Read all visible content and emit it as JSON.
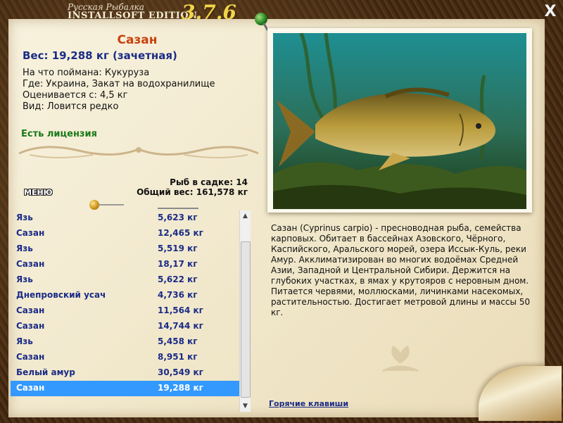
{
  "logo": {
    "line1": "Русская Рыбалка",
    "line2": "INSTALLSOFT EDITION",
    "version": "3.7.6"
  },
  "window": {
    "close_label": "X"
  },
  "catch": {
    "name": "Сазан",
    "weight": "Вес: 19,288 кг (зачетная)",
    "bait": "На что поймана: Кукуруза",
    "place": "Где: Украина, Закат на водохранилище",
    "rated_from": "Оценивается с: 4,5 кг",
    "kind": "Вид: Ловится редко",
    "license": "Есть лицензия"
  },
  "keepnet": {
    "count": "Рыб в садке: 14",
    "total_weight": "Общий вес: 161,578 кг"
  },
  "menu_label": "МЕНЮ",
  "catch_list": [
    {
      "name": "Язь",
      "weight": "5,623 кг"
    },
    {
      "name": "Сазан",
      "weight": "12,465 кг"
    },
    {
      "name": "Язь",
      "weight": "5,519 кг"
    },
    {
      "name": "Сазан",
      "weight": "18,17 кг"
    },
    {
      "name": "Язь",
      "weight": "5,622 кг"
    },
    {
      "name": "Днепровский усач",
      "weight": "4,736 кг"
    },
    {
      "name": "Сазан",
      "weight": "11,564 кг"
    },
    {
      "name": "Сазан",
      "weight": "14,744 кг"
    },
    {
      "name": "Язь",
      "weight": "5,458 кг"
    },
    {
      "name": "Сазан",
      "weight": "8,951 кг"
    },
    {
      "name": "Белый амур",
      "weight": "30,549 кг"
    },
    {
      "name": "Сазан",
      "weight": "19,288 кг",
      "selected": true
    }
  ],
  "description": "Сазан (Cyprinus carpio) - пресноводная рыба, семейства карповых. Обитает в бассейнах Азовского, Чёрного, Каспийского, Аральского морей, озера Иссык-Куль, реки Амур. Акклиматизирован во многих водоёмах Средней Азии, Западной и Центральной Сибири. Держится на глубоких участках, в ямах у крутояров с неровным дном. Питается червями, моллюсками, личинками насекомых, растительностью. Достигает метровой длины и массы 50 кг.",
  "hotkeys_label": "Горячие клавиши",
  "colors": {
    "accent_title": "#c8420e",
    "text_blue": "#1a2b86",
    "license_green": "#1a7a1a",
    "selection": "#3399ff"
  }
}
